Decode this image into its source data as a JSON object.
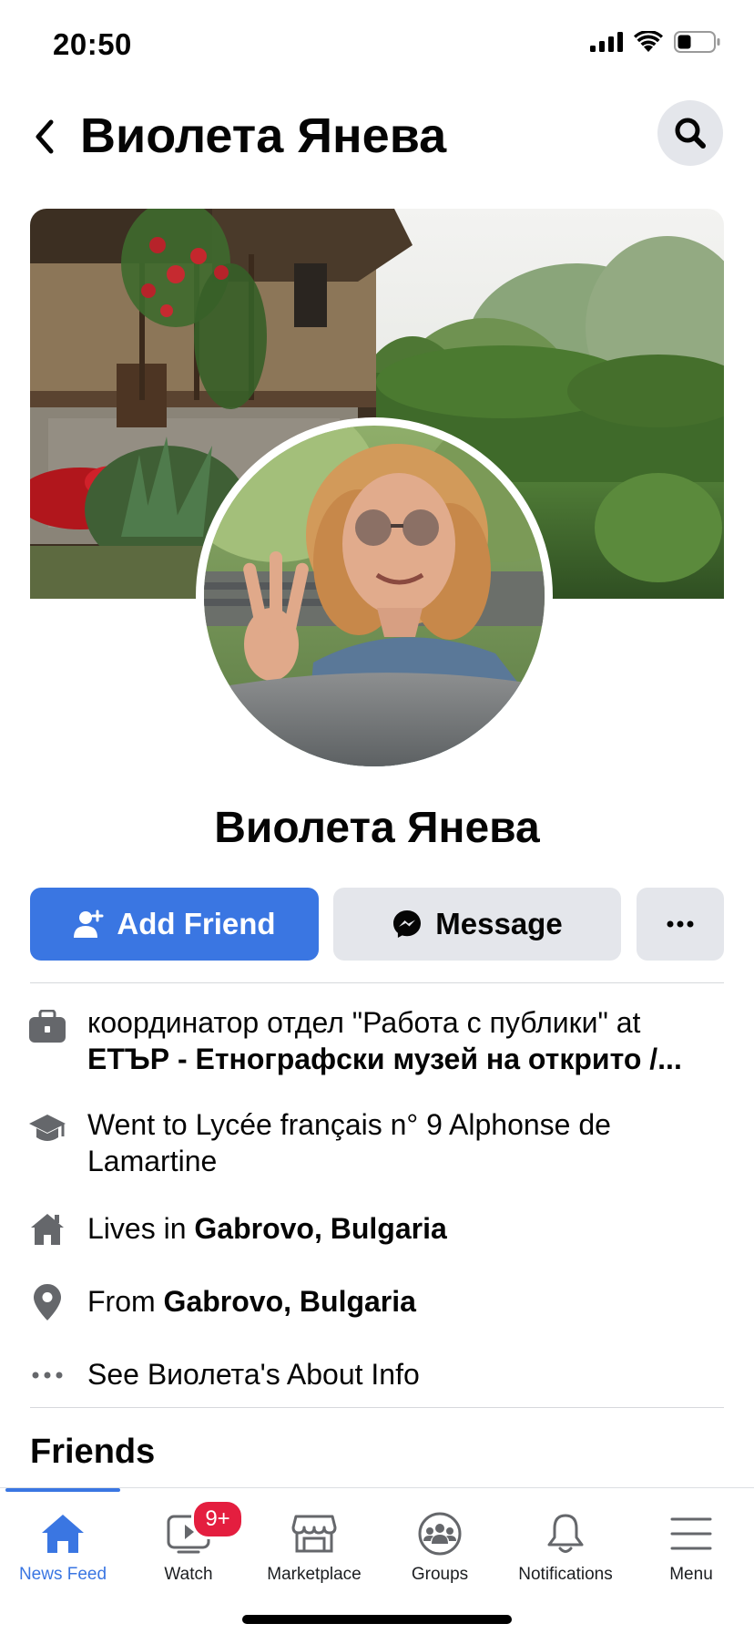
{
  "status_bar": {
    "time": "20:50"
  },
  "header": {
    "title": "Виолета Янева"
  },
  "profile": {
    "name": "Виолета Янева"
  },
  "actions": {
    "add_friend": "Add Friend",
    "message": "Message"
  },
  "intro": {
    "work_prefix": "координатор отдел \"Работа с публики\" at",
    "work_place": "ЕТЪР - Етнографски музей на открито /...",
    "education": "Went to Lycée français n° 9 Alphonse de Lamartine",
    "lives_prefix": "Lives in",
    "lives_place": "Gabrovo, Bulgaria",
    "from_prefix": "From",
    "from_place": "Gabrovo, Bulgaria",
    "see_about": "See Виолета's About Info"
  },
  "friends": {
    "heading": "Friends"
  },
  "tabs": [
    {
      "label": "News Feed",
      "icon": "home-icon",
      "active": true
    },
    {
      "label": "Watch",
      "icon": "watch-icon",
      "badge": "9+"
    },
    {
      "label": "Marketplace",
      "icon": "marketplace-icon"
    },
    {
      "label": "Groups",
      "icon": "groups-icon"
    },
    {
      "label": "Notifications",
      "icon": "bell-icon"
    },
    {
      "label": "Menu",
      "icon": "menu-icon"
    }
  ],
  "colors": {
    "accent": "#3a76e2",
    "badge": "#e41e3f",
    "button_gray": "#e4e6eb",
    "icon_gray": "#65676b"
  }
}
